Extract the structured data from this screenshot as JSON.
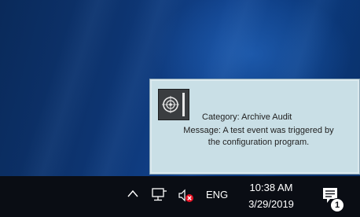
{
  "toast": {
    "icon": "target-event-icon",
    "category": "Category: Archive Audit",
    "message_line1": "Message: A test event was triggered by",
    "message_line2": "the configuration program."
  },
  "taskbar": {
    "tray_icons": [
      "chevron-up-icon",
      "network-icon",
      "volume-muted-icon"
    ],
    "language": "ENG",
    "time": "10:38 AM",
    "date": "3/29/2019",
    "action_center_icon": "notification-icon",
    "notification_count": "1"
  },
  "colors": {
    "desktop": "#0d3470",
    "taskbar": "#0a0d14",
    "toast_background": "#c9dfe6",
    "mute_red": "#e81123"
  }
}
